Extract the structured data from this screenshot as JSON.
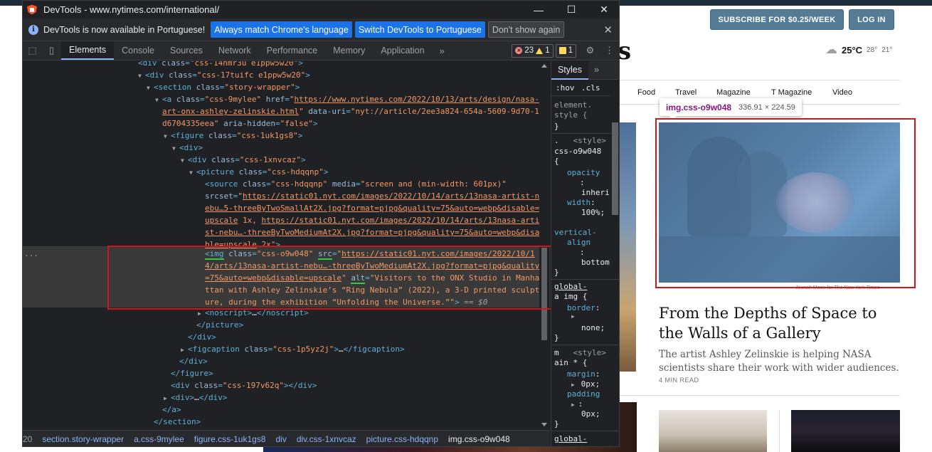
{
  "nyt": {
    "subscribe_label": "SUBSCRIBE FOR $0.25/WEEK",
    "login_label": "LOG IN",
    "weather": {
      "temp": "25°C",
      "high": "28°",
      "low": "21°"
    },
    "masthead_fragment": "s",
    "nav": [
      "Food",
      "Travel",
      "Magazine",
      "T Magazine",
      "Video"
    ],
    "image_credit": "Jeenah Moon for The New York Times",
    "headline": "From the Depths of Space to the Walls of a Gallery",
    "summary": "The artist Ashley Zelinskie is helping NASA scientists share their work with wider audiences.",
    "read_time": "4 MIN READ"
  },
  "tooltip": {
    "tag": "img.css-o9w048",
    "dims": "336.91 × 224.59"
  },
  "devtools": {
    "title": "DevTools - www.nytimes.com/international/",
    "infobar": {
      "message": "DevTools is now available in Portuguese!",
      "btn_match": "Always match Chrome's language",
      "btn_switch": "Switch DevTools to Portuguese",
      "btn_dont": "Don't show again"
    },
    "tabs": [
      "Elements",
      "Console",
      "Sources",
      "Network",
      "Performance",
      "Memory",
      "Application"
    ],
    "errors": "23",
    "warnings": "1",
    "issues": "1",
    "styles_tab": "Styles",
    "hov": ":hov",
    "cls": ".cls",
    "breadcrumbs": [
      "20",
      "section.story-wrapper",
      "a.css-9mylee",
      "figure.css-1uk1gs8",
      "div",
      "div.css-1xnvcaz",
      "picture.css-hdqqnp",
      "img.css-o9w048"
    ],
    "dom_dots": "...",
    "eq": "== $0"
  }
}
